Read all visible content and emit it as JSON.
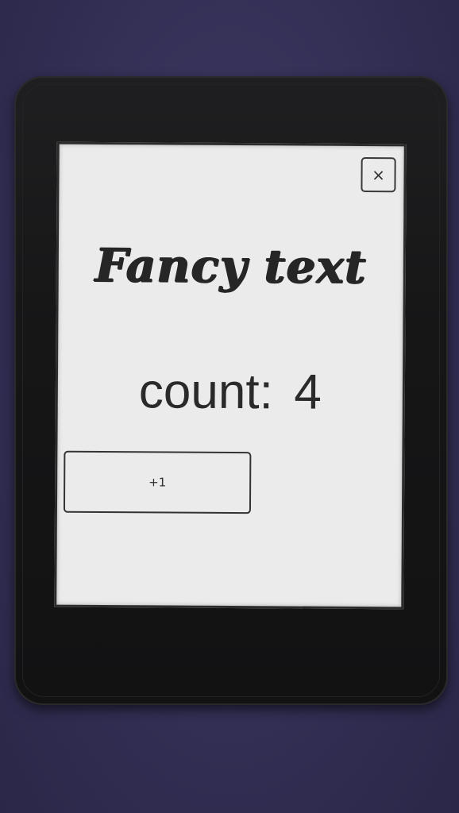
{
  "header": {
    "close_glyph": "×"
  },
  "content": {
    "fancy_title": "Fancy text",
    "count_label": "count:",
    "count_value": "4"
  },
  "actions": {
    "increment_label": "+1"
  },
  "colors": {
    "background": "#332f55",
    "device": "#161617",
    "screen": "#ebebeb",
    "ink": "#262626"
  }
}
